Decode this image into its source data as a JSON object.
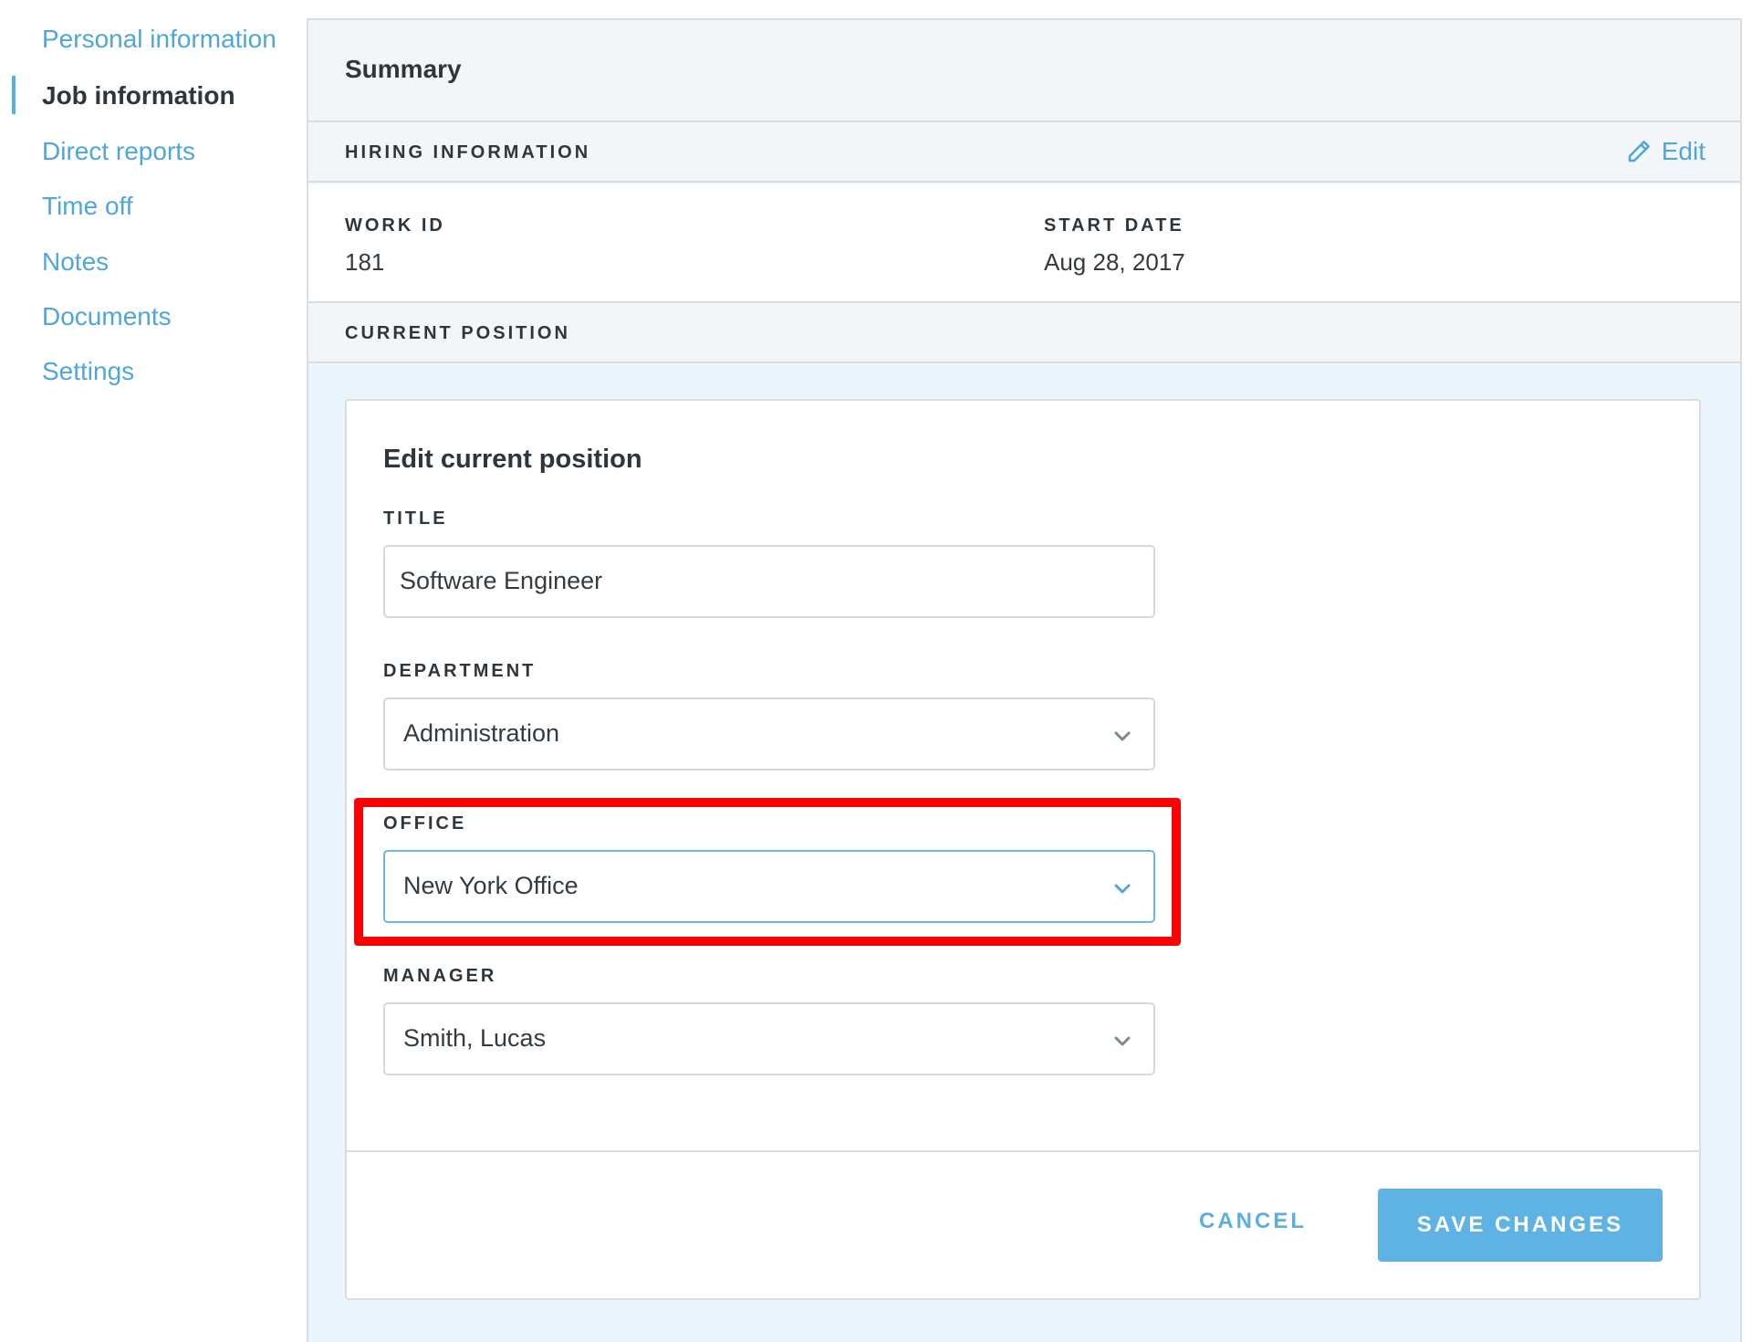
{
  "sidebar": {
    "items": [
      {
        "label": "Personal information",
        "active": false
      },
      {
        "label": "Job information",
        "active": true
      },
      {
        "label": "Direct reports",
        "active": false
      },
      {
        "label": "Time off",
        "active": false
      },
      {
        "label": "Notes",
        "active": false
      },
      {
        "label": "Documents",
        "active": false
      },
      {
        "label": "Settings",
        "active": false
      }
    ]
  },
  "summary": {
    "title": "Summary"
  },
  "hiring": {
    "label": "HIRING INFORMATION",
    "edit_label": "Edit",
    "work_id_label": "WORK ID",
    "work_id_value": "181",
    "start_date_label": "START DATE",
    "start_date_value": "Aug 28, 2017"
  },
  "position": {
    "label": "CURRENT POSITION"
  },
  "edit_form": {
    "title": "Edit current position",
    "title_field": {
      "label": "TITLE",
      "value": "Software Engineer"
    },
    "department_field": {
      "label": "DEPARTMENT",
      "value": "Administration"
    },
    "office_field": {
      "label": "OFFICE",
      "value": "New York Office"
    },
    "manager_field": {
      "label": "MANAGER",
      "value": "Smith, Lucas"
    },
    "cancel_label": "CANCEL",
    "save_label": "SAVE CHANGES"
  },
  "colors": {
    "accent": "#4fa6db",
    "highlight": "#ff0000",
    "save_button": "#5eb3e4"
  },
  "icons": {
    "edit": "pencil-icon",
    "dropdown": "chevron-down-icon"
  }
}
